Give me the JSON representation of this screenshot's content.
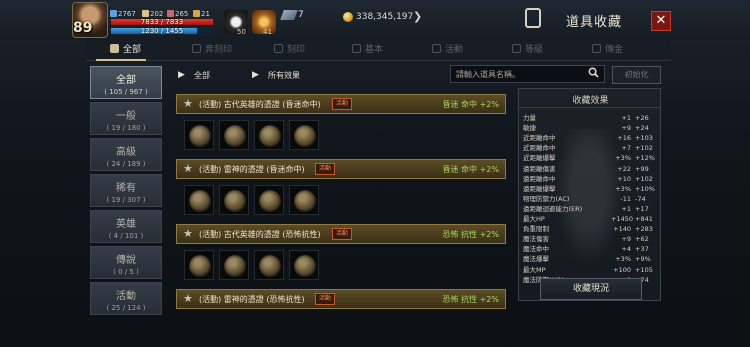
{
  "header": {
    "level": "89",
    "stats": [
      {
        "icon": "shield-icon",
        "value": "2767",
        "color": "#5aa0e6"
      },
      {
        "icon": "sword-icon",
        "value": "202",
        "color": "#d8c48a"
      },
      {
        "icon": "chart-icon",
        "value": "265",
        "color": "#c86a6a"
      },
      {
        "icon": "trophy-icon",
        "value": "21",
        "color": "#d8a640"
      }
    ],
    "hp": {
      "label": "7833 / 7833",
      "fraction": 1.0
    },
    "mp": {
      "label": "1230 / 1455",
      "fraction": 0.845
    },
    "buff_count_a": "50",
    "buff_count_b": "41",
    "quickslot_count": "7",
    "gold": "338,345,197",
    "title": "道具收藏",
    "close_label": "✕"
  },
  "tabs": [
    {
      "label": "全部",
      "icon": "book-icon",
      "active": true
    },
    {
      "label": "奔刻印",
      "icon": "stamp-icon",
      "active": false
    },
    {
      "label": "刻印",
      "icon": "mark-icon",
      "active": false
    },
    {
      "label": "基本",
      "icon": "helmet-icon",
      "active": false
    },
    {
      "label": "活動",
      "icon": "gift-icon",
      "active": false
    },
    {
      "label": "等級",
      "icon": "level-icon",
      "active": false
    },
    {
      "label": "傳金",
      "icon": "gear-icon",
      "active": false
    }
  ],
  "categories": [
    {
      "name": "全部",
      "count": "( 105 / 967 )",
      "active": true
    },
    {
      "name": "一般",
      "count": "( 19 / 180 )",
      "active": false
    },
    {
      "name": "高級",
      "count": "( 24 / 189 )",
      "active": false
    },
    {
      "name": "稀有",
      "count": "( 19 / 307 )",
      "active": false
    },
    {
      "name": "英雄",
      "count": "( 4 / 101 )",
      "active": false
    },
    {
      "name": "傳說",
      "count": "( 0 / 5 )",
      "active": false
    },
    {
      "name": "活動",
      "count": "( 25 / 124 )",
      "active": false
    }
  ],
  "filters": {
    "all_label": "全部",
    "effect_label": "所有效果",
    "search_placeholder": "請輸入道具名稱。",
    "init_label": "初始化"
  },
  "collections": [
    {
      "name": "(活動) 古代英雄的憑證 (昏迷命中)",
      "badge": "活動",
      "effect": "昏迷 命中 +2%",
      "slots": 4
    },
    {
      "name": "(活動) 雷神的憑證 (昏迷命中)",
      "badge": "活動",
      "effect": "昏迷 命中 +2%",
      "slots": 4
    },
    {
      "name": "(活動) 古代英雄的憑證 (恐怖抗性)",
      "badge": "活動",
      "effect": "恐怖 抗性 +2%",
      "slots": 4
    },
    {
      "name": "(活動) 雷神的憑證 (恐怖抗性)",
      "badge": "活動",
      "effect": "恐怖 抗性 +2%",
      "slots": 4
    }
  ],
  "effects_panel": {
    "title": "收藏效果",
    "rows": [
      {
        "name": "力量",
        "a": "+1",
        "b": "+26"
      },
      {
        "name": "敏捷",
        "a": "+9",
        "b": "+24"
      },
      {
        "name": "近距離命中",
        "a": "+16",
        "b": "+103"
      },
      {
        "name": "近距離命中",
        "a": "+7",
        "b": "+102"
      },
      {
        "name": "近距離爆擊",
        "a": "+3%",
        "b": "+12%"
      },
      {
        "name": "遠距離傷害",
        "a": "+22",
        "b": "+99"
      },
      {
        "name": "遠距離命中",
        "a": "+10",
        "b": "+102"
      },
      {
        "name": "遠距離爆擊",
        "a": "+3%",
        "b": "+10%"
      },
      {
        "name": "物理防禦力(AC)",
        "a": "-11",
        "b": "-74"
      },
      {
        "name": "遠距離迴避能力(ER)",
        "a": "+1",
        "b": "+17"
      },
      {
        "name": "最大HP",
        "a": "+1450",
        "b": "+841"
      },
      {
        "name": "負重限制",
        "a": "+140",
        "b": "+283"
      },
      {
        "name": "魔法傷害",
        "a": "+9",
        "b": "+62"
      },
      {
        "name": "魔法命中",
        "a": "+4",
        "b": "+37"
      },
      {
        "name": "魔法爆擊",
        "a": "+3%",
        "b": "+9%"
      },
      {
        "name": "最大MP",
        "a": "+100",
        "b": "+105"
      },
      {
        "name": "魔法防禦(MR)",
        "a": "+8",
        "b": "+74"
      }
    ],
    "status_button": "收藏現況"
  },
  "colors": {
    "accent_gold": "#d7c08a",
    "effect_green": "#a9d85d",
    "close_red": "#7b1712"
  }
}
